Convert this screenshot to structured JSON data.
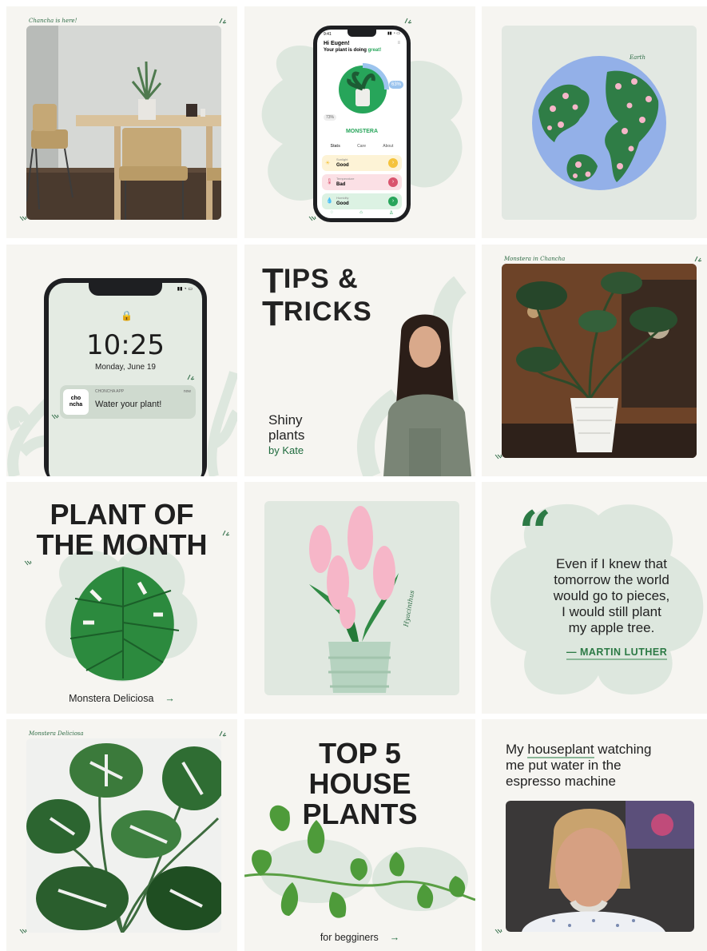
{
  "tiles": {
    "t1": {
      "caption": "Chancha is here!"
    },
    "t2": {
      "time": "9:41",
      "greeting": "Hi Eugen!",
      "status_prefix": "Your plant is doing ",
      "status_word": "great!",
      "percent_right": "63%",
      "percent_left": "73%",
      "plant_name": "MONSTERA",
      "tabs": [
        "Stats",
        "Care",
        "About"
      ],
      "rows": [
        {
          "label": "Sunlight",
          "value": "Good",
          "color": "#f5c33b",
          "bg": "#fdf3d6"
        },
        {
          "label": "Temperature",
          "value": "Bad",
          "color": "#d9546e",
          "bg": "#fbe0e5"
        },
        {
          "label": "Humidity",
          "value": "Good",
          "color": "#27a55a",
          "bg": "#dcf2e3"
        }
      ]
    },
    "t3": {
      "caption": "Earth"
    },
    "t4": {
      "time": "10:25",
      "date": "Monday, June 19",
      "app_name": "CHONCHA APP",
      "app_icon_text_1": "cho",
      "app_icon_text_2": "ncha",
      "notif_time": "now",
      "message": "Water your plant!"
    },
    "t5": {
      "title_big_1": "T",
      "title_rest_1": "IPS &",
      "title_big_2": "T",
      "title_rest_2": "RICKS",
      "sub_1": "Shiny",
      "sub_2": "plants",
      "sub_3": "by Kate"
    },
    "t6": {
      "caption": "Monstera in Chancha"
    },
    "t7": {
      "title_1": "PLANT OF",
      "title_2": "THE MONTH",
      "caption": "Monstera Deliciosa",
      "arrow": "→"
    },
    "t8": {
      "caption": "Hyacinthus"
    },
    "t9": {
      "quote_mark": "“",
      "quote_lines": [
        "Even if I knew that",
        "tomorrow the world",
        "would go to pieces,",
        "I would still plant",
        "my apple tree."
      ],
      "author": "— MARTIN LUTHER"
    },
    "t10": {
      "caption": "Monstera Deliciosa"
    },
    "t11": {
      "title_1": "TOP 5",
      "title_2": "HOUSE",
      "title_3": "PLANTS",
      "caption": "for begginers",
      "arrow": "→"
    },
    "t12": {
      "line1_a": "My ",
      "line1_b": "houseplant",
      "line1_c": " watching",
      "line2": "me put water in the",
      "line3": "espresso machine"
    }
  },
  "colors": {
    "accent": "#1f6b3e",
    "pale": "#dde7de",
    "pink": "#f6b6c8",
    "background": "#f6f5f1"
  }
}
